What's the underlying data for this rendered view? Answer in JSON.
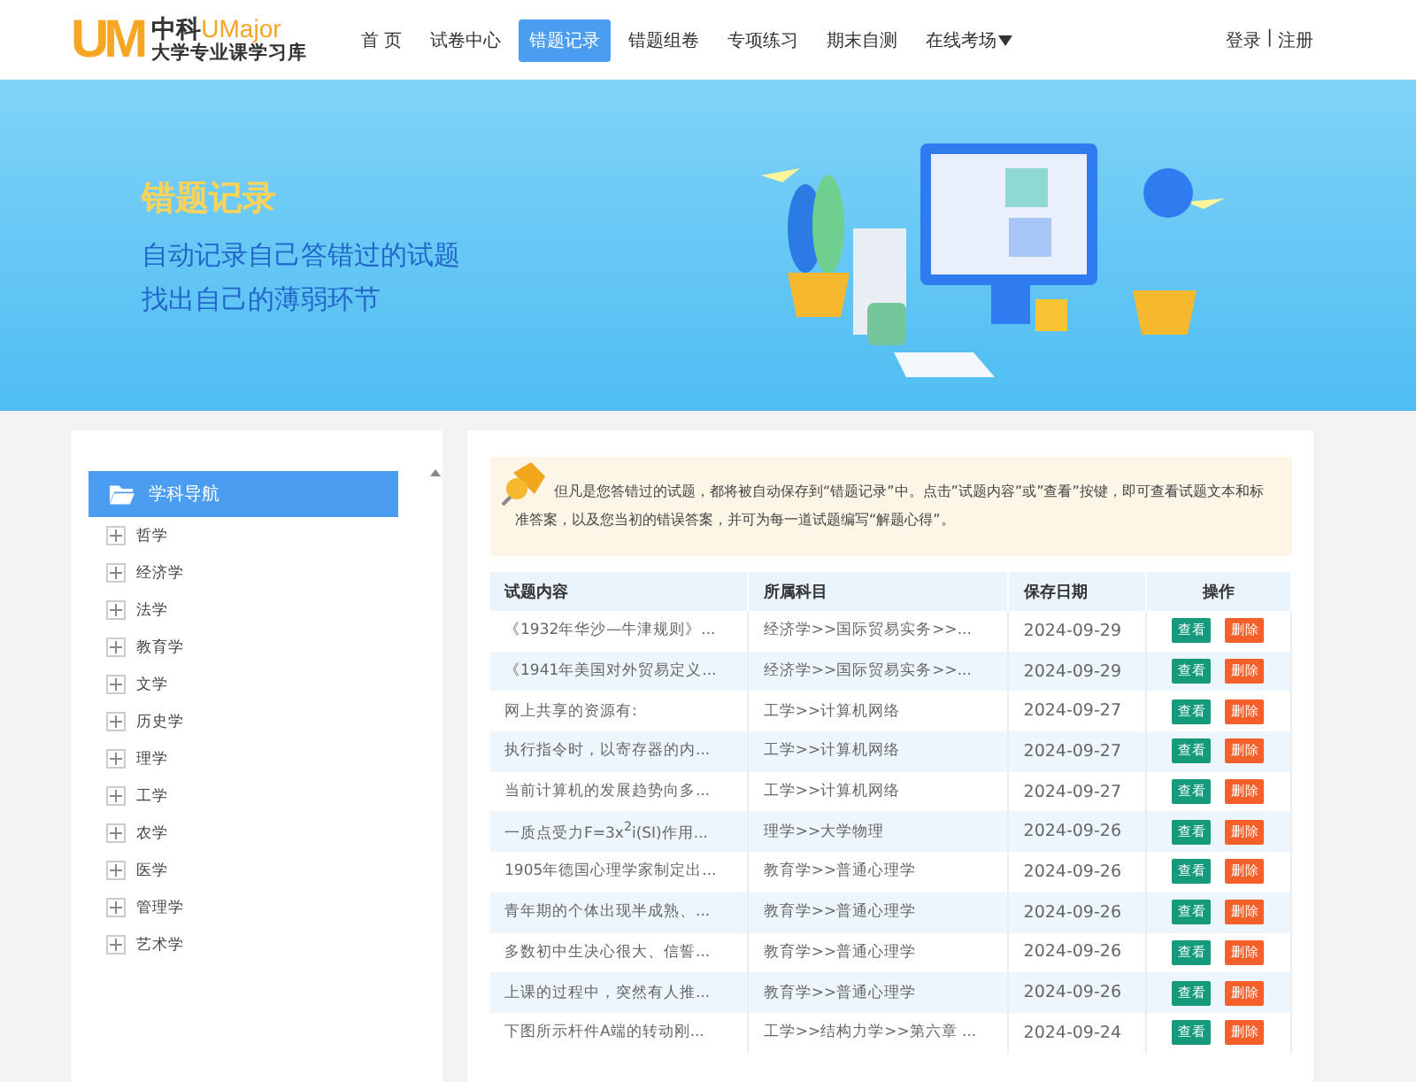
{
  "logo": {
    "mark": "UM",
    "brand_cn": "中科",
    "brand_en": "UMajor",
    "subtitle": "大学专业课学习库"
  },
  "nav": [
    {
      "label": "首 页",
      "selected": false,
      "dropdown": false
    },
    {
      "label": "试卷中心",
      "selected": false,
      "dropdown": false
    },
    {
      "label": "错题记录",
      "selected": true,
      "dropdown": false
    },
    {
      "label": "错题组卷",
      "selected": false,
      "dropdown": false
    },
    {
      "label": "专项练习",
      "selected": false,
      "dropdown": false
    },
    {
      "label": "期末自测",
      "selected": false,
      "dropdown": false
    },
    {
      "label": "在线考场",
      "selected": false,
      "dropdown": true
    }
  ],
  "account": {
    "login": "登录",
    "separator": "|",
    "register": "注册"
  },
  "banner": {
    "title": "错题记录",
    "lines": [
      "自动记录自己答错过的试题",
      "找出自己的薄弱环节"
    ]
  },
  "sidebar": {
    "title": "学科导航",
    "items": [
      {
        "label": "哲学",
        "expanded": false
      },
      {
        "label": "经济学",
        "expanded": false
      },
      {
        "label": "法学",
        "expanded": false
      },
      {
        "label": "教育学",
        "expanded": false
      },
      {
        "label": "文学",
        "expanded": false
      },
      {
        "label": "历史学",
        "expanded": false
      },
      {
        "label": "理学",
        "expanded": false
      },
      {
        "label": "工学",
        "expanded": false
      },
      {
        "label": "农学",
        "expanded": false
      },
      {
        "label": "医学",
        "expanded": false
      },
      {
        "label": "管理学",
        "expanded": false
      },
      {
        "label": "艺术学",
        "expanded": false
      }
    ]
  },
  "notice": "但凡是您答错过的试题，都将被自动保存到“错题记录”中。点击”试题内容”或”查看”按键，即可查看试题文本和标准答案，以及您当初的错误答案，并可为每一道试题编写“解题心得”。",
  "table": {
    "columns": [
      "试题内容",
      "所属科目",
      "保存日期",
      "操作"
    ],
    "rows": [
      {
        "content": "《1932年华沙—牛津规则》...",
        "subject": "经济学>>国际贸易实务>>...",
        "date": "2024-09-29",
        "view": "查看",
        "delete": "删除"
      },
      {
        "content": "《1941年美国对外贸易定义...",
        "subject": "经济学>>国际贸易实务>>...",
        "date": "2024-09-29",
        "view": "查看",
        "delete": "删除"
      },
      {
        "content": "网上共享的资源有:",
        "subject": "工学>>计算机网络",
        "date": "2024-09-27",
        "view": "查看",
        "delete": "删除"
      },
      {
        "content": "执行指令时，以寄存器的内...",
        "subject": "工学>>计算机网络",
        "date": "2024-09-27",
        "view": "查看",
        "delete": "删除"
      },
      {
        "content": "当前计算机的发展趋势向多...",
        "subject": "工学>>计算机网络",
        "date": "2024-09-27",
        "view": "查看",
        "delete": "删除"
      },
      {
        "content": "一质点受力F=3x$^{2}$i(SI)作用...",
        "subject": "理学>>大学物理",
        "date": "2024-09-26",
        "view": "查看",
        "delete": "删除"
      },
      {
        "content": "1905年德国心理学家制定出...",
        "subject": "教育学>>普通心理学",
        "date": "2024-09-26",
        "view": "查看",
        "delete": "删除"
      },
      {
        "content": "青年期的个体出现半成熟、...",
        "subject": "教育学>>普通心理学",
        "date": "2024-09-26",
        "view": "查看",
        "delete": "删除"
      },
      {
        "content": "多数初中生决心很大、信誓...",
        "subject": "教育学>>普通心理学",
        "date": "2024-09-26",
        "view": "查看",
        "delete": "删除"
      },
      {
        "content": "上课的过程中，突然有人推...",
        "subject": "教育学>>普通心理学",
        "date": "2024-09-26",
        "view": "查看",
        "delete": "删除"
      },
      {
        "content": "下图所示杆件A端的转动刚...",
        "subject": "工学>>结构力学>>第六章 ...",
        "date": "2024-09-24",
        "view": "查看",
        "delete": "删除"
      }
    ]
  }
}
